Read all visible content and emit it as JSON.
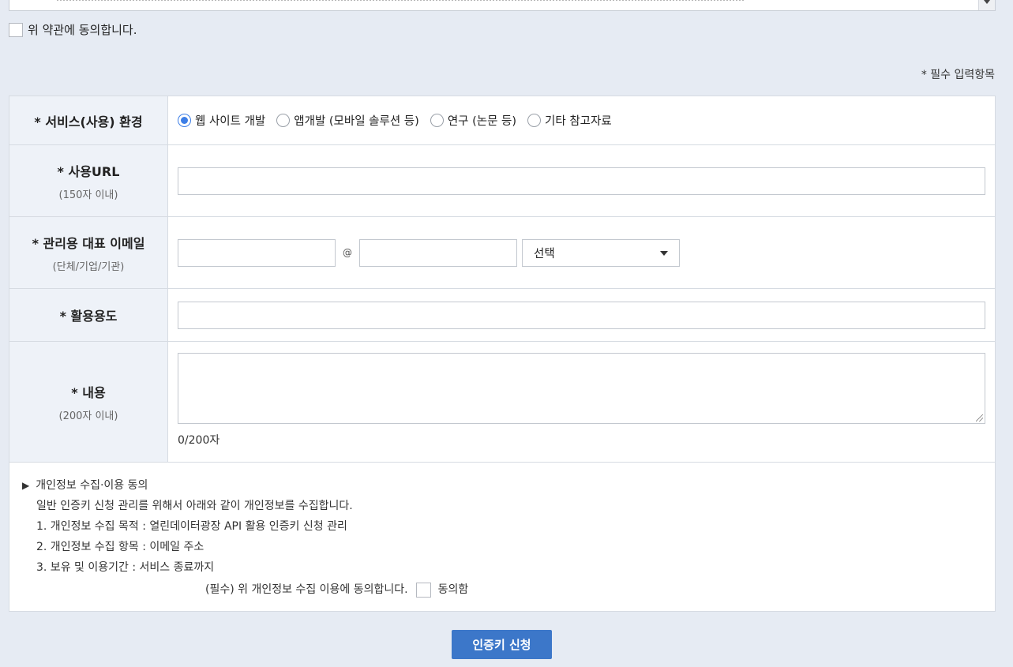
{
  "terms": {
    "agree_label": "위 약관에 동의합니다."
  },
  "required_note": "* 필수 입력항목",
  "form": {
    "env": {
      "label": "* 서비스(사용) 환경",
      "options": [
        "웹 사이트 개발",
        "앱개발 (모바일 솔루션 등)",
        "연구 (논문 등)",
        "기타 참고자료"
      ],
      "selected": "웹 사이트 개발"
    },
    "url": {
      "label": "* 사용URL",
      "sub": "(150자 이내)",
      "value": ""
    },
    "email": {
      "label": "* 관리용 대표 이메일",
      "sub": "(단체/기업/기관)",
      "local": "",
      "at": "@",
      "domain": "",
      "select_value": "선택"
    },
    "purpose": {
      "label": "* 활용용도",
      "value": ""
    },
    "content": {
      "label": "* 내용",
      "sub": "(200자 이내)",
      "value": "",
      "counter": "0/200자"
    }
  },
  "privacy": {
    "title": "개인정보 수집·이용 동의",
    "lines": [
      "일반 인증키 신청 관리를 위해서 아래와 같이 개인정보를 수집합니다.",
      "1. 개인정보 수집 목적 : 열린데이터광장 API 활용 인증키 신청 관리",
      "2. 개인정보 수집 항목 : 이메일 주소",
      "3. 보유 및 이용기간 : 서비스 종료까지"
    ],
    "consent_text": "(필수) 위 개인정보 수집 이용에 동의합니다.",
    "consent_label": "동의함"
  },
  "submit_label": "인증키 신청",
  "colors": {
    "accent": "#3c77c9",
    "radio": "#3d7ee6",
    "page_bg": "#e6ebf3",
    "th_bg": "#eef2f8"
  }
}
